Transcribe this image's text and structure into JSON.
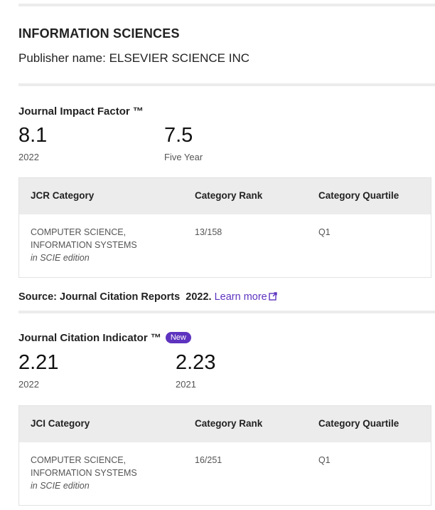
{
  "journal": {
    "title": "INFORMATION SCIENCES",
    "publisher": "Publisher name: ELSEVIER SCIENCE INC"
  },
  "jif": {
    "title": "Journal Impact Factor ™",
    "value_current": "8.1",
    "label_current": "2022",
    "value_five_year": "7.5",
    "label_five_year": "Five Year",
    "table": {
      "headers": [
        "JCR Category",
        "Category Rank",
        "Category Quartile"
      ],
      "row": {
        "category_line1": "COMPUTER SCIENCE,",
        "category_line2": "INFORMATION SYSTEMS",
        "edition": "in SCIE edition",
        "rank": "13/158",
        "quartile": "Q1"
      }
    }
  },
  "source": {
    "text": "Source: Journal Citation Reports  2022.",
    "link_label": "Learn more",
    "link_icon": "external-link-icon"
  },
  "jci": {
    "title": "Journal Citation Indicator ™",
    "badge": "New",
    "value_current": "2.21",
    "label_current": "2022",
    "value_previous": "2.23",
    "label_previous": "2021",
    "table": {
      "headers": [
        "JCI Category",
        "Category Rank",
        "Category Quartile"
      ],
      "row": {
        "category_line1": "COMPUTER SCIENCE,",
        "category_line2": "INFORMATION SYSTEMS",
        "edition": "in SCIE edition",
        "rank": "16/251",
        "quartile": "Q1"
      }
    }
  },
  "colors": {
    "accent": "#5e33bf",
    "table_header_bg": "#ececec",
    "divider": "#ececec"
  }
}
